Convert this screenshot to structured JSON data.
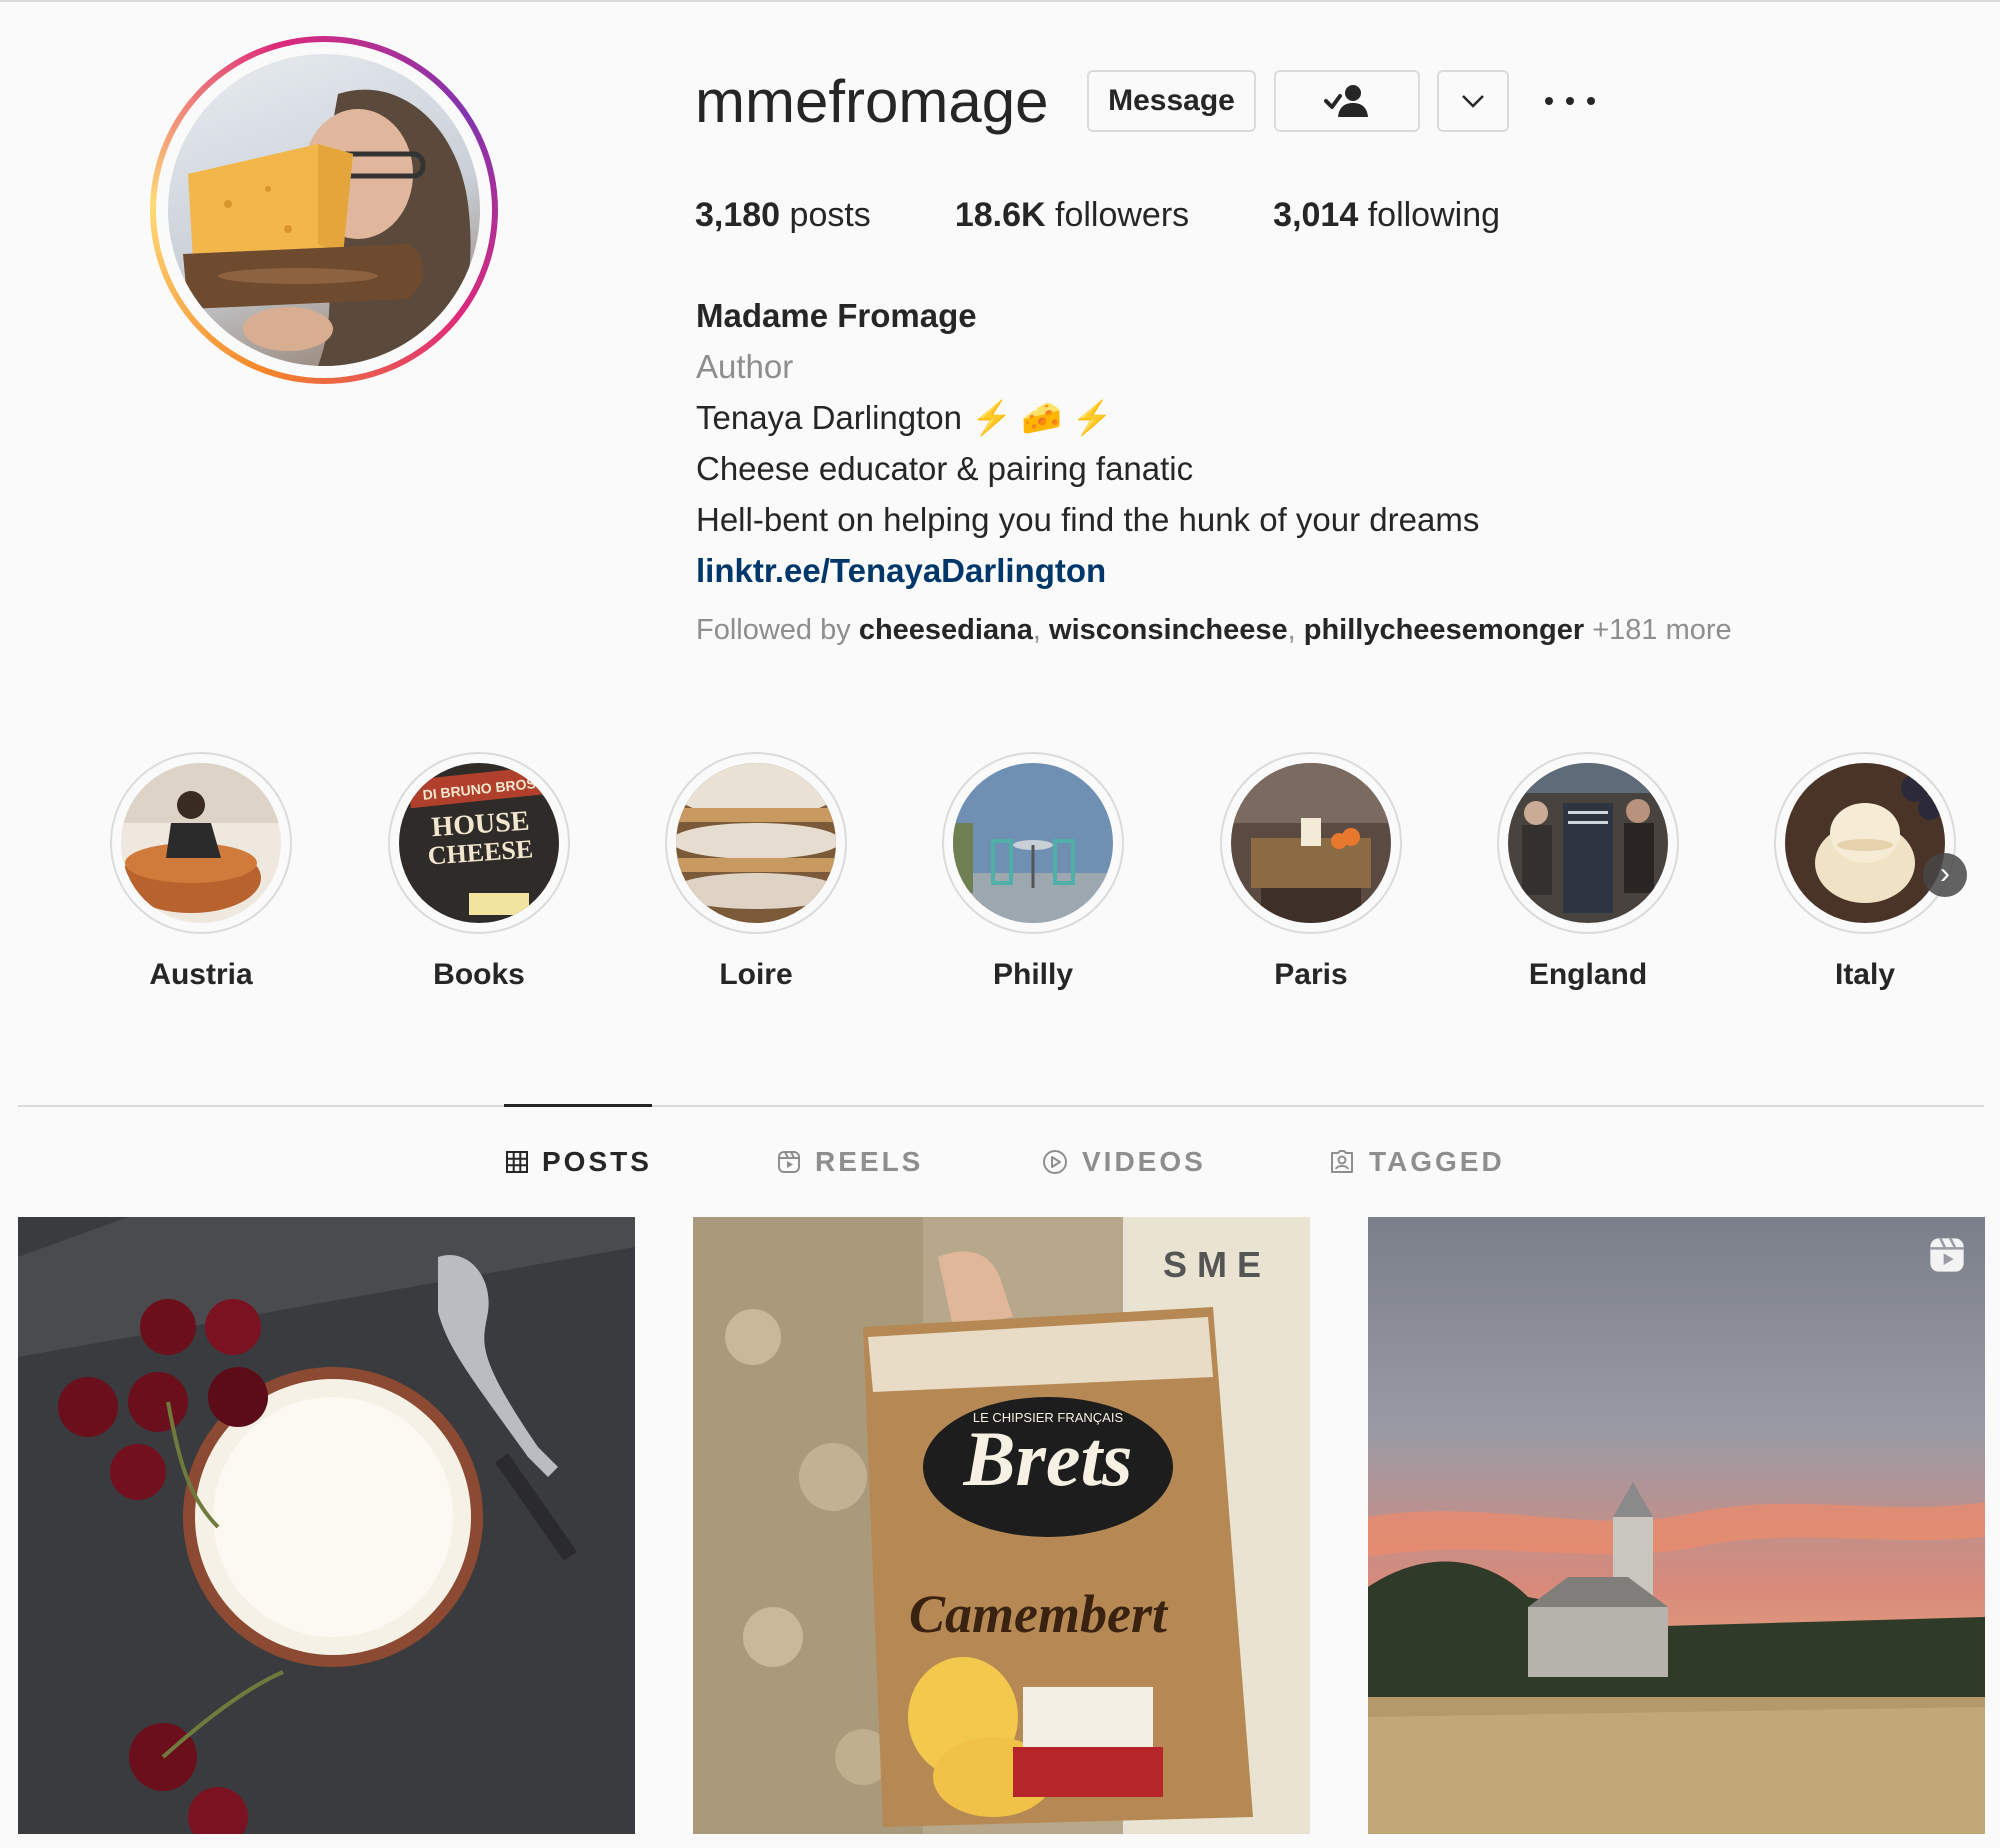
{
  "profile": {
    "username": "mmefromage",
    "message_label": "Message",
    "stats": {
      "posts_count": "3,180",
      "posts_label": "posts",
      "followers_count": "18.6K",
      "followers_label": "followers",
      "following_count": "3,014",
      "following_label": "following"
    },
    "bio": {
      "name": "Madame Fromage",
      "category": "Author",
      "line1": "Tenaya Darlington",
      "line1_emoji": "⚡ 🧀 ⚡",
      "line2": "Cheese educator & pairing fanatic",
      "line3": "Hell-bent on helping you find the hunk of your dreams",
      "link": "linktr.ee/TenayaDarlington"
    },
    "followed_by": {
      "prefix": "Followed by",
      "users": [
        "cheesediana",
        "wisconsincheese",
        "phillycheesemonger"
      ],
      "more": "+181 more"
    }
  },
  "highlights": [
    {
      "label": "Austria"
    },
    {
      "label": "Books"
    },
    {
      "label": "Loire"
    },
    {
      "label": "Philly"
    },
    {
      "label": "Paris"
    },
    {
      "label": "England"
    },
    {
      "label": "Italy"
    }
  ],
  "books_highlight_art": {
    "line1": "DI BRUNO BROS",
    "line2": "HOUSE",
    "line3": "CHEESE"
  },
  "tabs": [
    {
      "label": "POSTS",
      "icon": "grid-icon",
      "active": true
    },
    {
      "label": "REELS",
      "icon": "reels-icon",
      "active": false
    },
    {
      "label": "VIDEOS",
      "icon": "play-circle-icon",
      "active": false
    },
    {
      "label": "TAGGED",
      "icon": "tagged-icon",
      "active": false
    }
  ],
  "posts": [
    {
      "subject": "cheese-with-cherries"
    },
    {
      "subject": "brets-chips-bag",
      "bag_brand": "Brets",
      "bag_top": "LE CHIPSIER FRANÇAIS",
      "bag_flavor": "Camembert",
      "fridge_logo": "S M E"
    },
    {
      "subject": "field-sunset-church",
      "badge": "reels-icon"
    }
  ],
  "colors": {
    "link": "#00376b",
    "secondary_text": "#8e8e8e",
    "border": "#dbdbdb",
    "background": "#fafafa"
  }
}
